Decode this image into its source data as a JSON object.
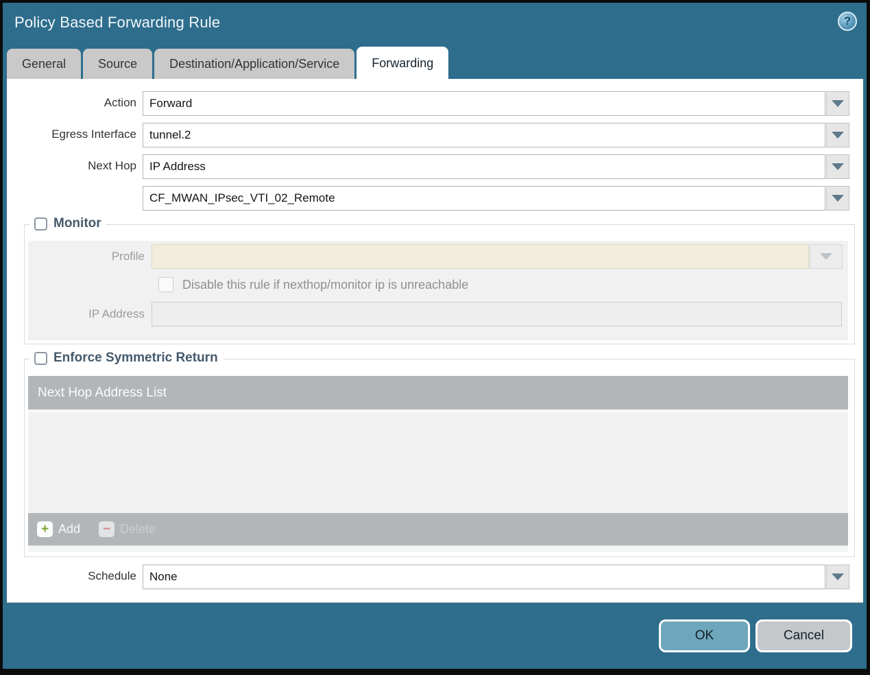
{
  "dialog": {
    "title": "Policy Based Forwarding Rule"
  },
  "icons": {
    "help": "?",
    "add": "+",
    "delete": "−"
  },
  "tabs": [
    {
      "label": "General",
      "active": false
    },
    {
      "label": "Source",
      "active": false
    },
    {
      "label": "Destination/Application/Service",
      "active": false
    },
    {
      "label": "Forwarding",
      "active": true
    }
  ],
  "form": {
    "action": {
      "label": "Action",
      "value": "Forward"
    },
    "egress_interface": {
      "label": "Egress Interface",
      "value": "tunnel.2"
    },
    "next_hop": {
      "label": "Next Hop",
      "value": "IP Address"
    },
    "next_hop_address": {
      "value": "CF_MWAN_IPsec_VTI_02_Remote"
    },
    "schedule": {
      "label": "Schedule",
      "value": "None"
    }
  },
  "monitor": {
    "legend": "Monitor",
    "checked": false,
    "profile": {
      "label": "Profile",
      "value": ""
    },
    "disable_checkbox": {
      "label": "Disable this rule if nexthop/monitor ip is unreachable",
      "checked": false
    },
    "ip_address": {
      "label": "IP Address",
      "value": ""
    }
  },
  "symmetric_return": {
    "legend": "Enforce Symmetric Return",
    "checked": false,
    "table_header": "Next Hop Address List",
    "rows": [],
    "add_label": "Add",
    "delete_label": "Delete"
  },
  "footer": {
    "ok_label": "OK",
    "cancel_label": "Cancel"
  },
  "colors": {
    "titlebar": "#2e6d8c",
    "ok_button": "#6ea6bb",
    "cancel_button": "#c5c8cb",
    "table_header": "#b2b6b9",
    "disabled_cream_field": "#f2edda",
    "section_title": "#44596b"
  }
}
